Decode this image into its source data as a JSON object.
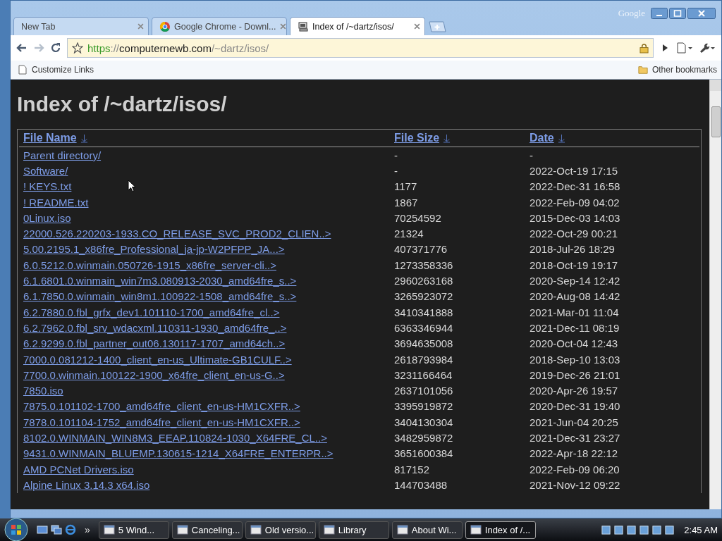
{
  "window": {
    "brand": "Google"
  },
  "tabs": [
    {
      "title": "New Tab",
      "selected": false,
      "kind": "blank"
    },
    {
      "title": "Google Chrome - Downl...",
      "selected": false,
      "kind": "download"
    },
    {
      "title": "Index of /~dartz/isos/",
      "selected": true,
      "kind": "site"
    }
  ],
  "address": {
    "scheme": "https",
    "separator": "://",
    "host": "computernewb.com",
    "path": "/~dartz/isos/"
  },
  "bookmarks": {
    "left": "Customize Links",
    "right": "Other bookmarks"
  },
  "page": {
    "heading": "Index of /~dartz/isos/",
    "columns": [
      {
        "label": "File Name"
      },
      {
        "label": "File Size"
      },
      {
        "label": "Date"
      }
    ],
    "rows": [
      {
        "name": "Parent directory/",
        "size": "-",
        "date": "-"
      },
      {
        "name": "Software/",
        "size": "-",
        "date": "2022-Oct-19 17:15"
      },
      {
        "name": "! KEYS.txt",
        "size": "1177",
        "date": "2022-Dec-31 16:58"
      },
      {
        "name": "! README.txt",
        "size": "1867",
        "date": "2022-Feb-09 04:02"
      },
      {
        "name": "0Linux.iso",
        "size": "70254592",
        "date": "2015-Dec-03 14:03"
      },
      {
        "name": "22000.526.220203-1933.CO_RELEASE_SVC_PROD2_CLIEN..>",
        "size": "21324",
        "date": "2022-Oct-29 00:21"
      },
      {
        "name": "5.00.2195.1_x86fre_Professional_ja-jp-W2PFPP_JA...>",
        "size": "407371776",
        "date": "2018-Jul-26 18:29"
      },
      {
        "name": "6.0.5212.0.winmain.050726-1915_x86fre_server-cli..>",
        "size": "1273358336",
        "date": "2018-Oct-19 19:17"
      },
      {
        "name": "6.1.6801.0.winmain_win7m3.080913-2030_amd64fre_s..>",
        "size": "2960263168",
        "date": "2020-Sep-14 12:42"
      },
      {
        "name": "6.1.7850.0.winmain_win8m1.100922-1508_amd64fre_s..>",
        "size": "3265923072",
        "date": "2020-Aug-08 14:42"
      },
      {
        "name": "6.2.7880.0.fbl_grfx_dev1.101110-1700_amd64fre_cl..>",
        "size": "3410341888",
        "date": "2021-Mar-01 11:04"
      },
      {
        "name": "6.2.7962.0.fbl_srv_wdacxml.110311-1930_amd64fre_..>",
        "size": "6363346944",
        "date": "2021-Dec-11 08:19"
      },
      {
        "name": "6.2.9299.0.fbl_partner_out06.130117-1707_amd64ch..>",
        "size": "3694635008",
        "date": "2020-Oct-04 12:43"
      },
      {
        "name": "7000.0.081212-1400_client_en-us_Ultimate-GB1CULF..>",
        "size": "2618793984",
        "date": "2018-Sep-10 13:03"
      },
      {
        "name": "7700.0.winmain.100122-1900_x64fre_client_en-us-G..>",
        "size": "3231166464",
        "date": "2019-Dec-26 21:01"
      },
      {
        "name": "7850.iso",
        "size": "2637101056",
        "date": "2020-Apr-26 19:57"
      },
      {
        "name": "7875.0.101102-1700_amd64fre_client_en-us-HM1CXFR..>",
        "size": "3395919872",
        "date": "2020-Dec-31 19:40"
      },
      {
        "name": "7878.0.101104-1752_amd64fre_client_en-us-HM1CXFR..>",
        "size": "3404130304",
        "date": "2021-Jun-04 20:25"
      },
      {
        "name": "8102.0.WINMAIN_WIN8M3_EEAP.110824-1030_X64FRE_CL..>",
        "size": "3482959872",
        "date": "2021-Dec-31 23:27"
      },
      {
        "name": "9431.0.WINMAIN_BLUEMP.130615-1214_X64FRE_ENTERPR..>",
        "size": "3651600384",
        "date": "2022-Apr-18 22:12"
      },
      {
        "name": "AMD PCNet Drivers.iso",
        "size": "817152",
        "date": "2022-Feb-09 06:20"
      },
      {
        "name": "Alpine Linux 3.14.3 x64.iso",
        "size": "144703488",
        "date": "2021-Nov-12 09:22"
      }
    ]
  },
  "taskbar": {
    "quick_launch_more": "»",
    "items": [
      {
        "label": "5 Wind...",
        "selected": false
      },
      {
        "label": "Canceling...",
        "selected": false
      },
      {
        "label": "Old versio...",
        "selected": false
      },
      {
        "label": "Library",
        "selected": false
      },
      {
        "label": "About Wi...",
        "selected": false
      },
      {
        "label": "Index of /...",
        "selected": true
      }
    ],
    "clock": "2:45 AM"
  }
}
